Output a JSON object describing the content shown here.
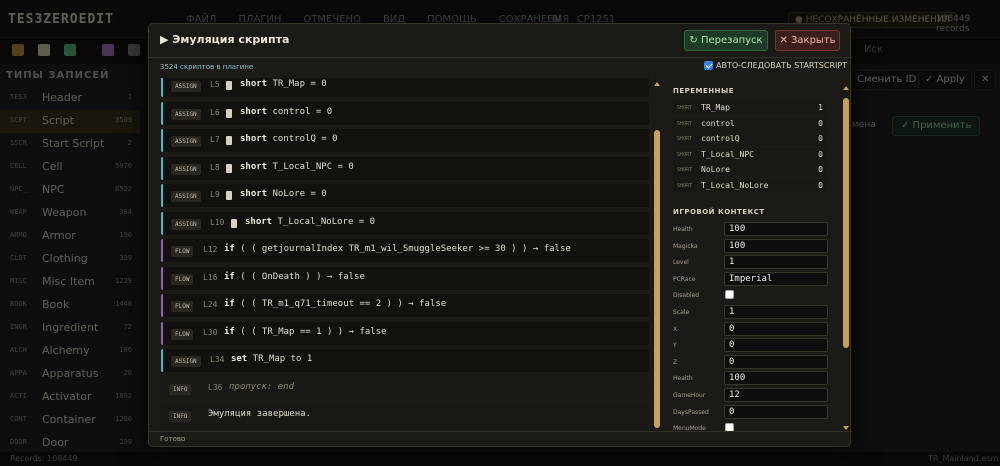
{
  "app": {
    "logo": "TES3ZEROEDIT",
    "menu": [
      "ФАЙЛ",
      "ПЛАГИН",
      "ОТМЕЧЕНО",
      "ВИД",
      "ПОМОЩЬ",
      "СОХРАНЕНИЯ"
    ],
    "lang": [
      "EN",
      "CP1251"
    ],
    "unsaved": "● НЕСОХРАНЁННЫЕ ИЗМЕНЕНИЯ",
    "record_count": "108449 records",
    "search_placeholder": "Иск",
    "sidebar_title": "ТИПЫ ЗАПИСЕЙ",
    "sidebar": [
      {
        "code": "TES3",
        "name": "Header",
        "count": "1"
      },
      {
        "code": "SCPT",
        "name": "Script",
        "count": "3509"
      },
      {
        "code": "SSCR",
        "name": "Start Script",
        "count": "2"
      },
      {
        "code": "CELL",
        "name": "Cell",
        "count": "5970"
      },
      {
        "code": "NPC_",
        "name": "NPC",
        "count": "8522"
      },
      {
        "code": "WEAP",
        "name": "Weapon",
        "count": "384"
      },
      {
        "code": "ARMO",
        "name": "Armor",
        "count": "190"
      },
      {
        "code": "CLOT",
        "name": "Clothing",
        "count": "339"
      },
      {
        "code": "MISC",
        "name": "Misc Item",
        "count": "1229"
      },
      {
        "code": "BOOK",
        "name": "Book",
        "count": "1440"
      },
      {
        "code": "INGR",
        "name": "Ingredient",
        "count": "72"
      },
      {
        "code": "ALCH",
        "name": "Alchemy",
        "count": "106"
      },
      {
        "code": "APPA",
        "name": "Apparatus",
        "count": "20"
      },
      {
        "code": "ACTI",
        "name": "Activator",
        "count": "1892"
      },
      {
        "code": "CONT",
        "name": "Container",
        "count": "1206"
      },
      {
        "code": "DOOR",
        "name": "Door",
        "count": "239"
      }
    ],
    "status_left": "Records: 108449",
    "status_right": "TR_Mainland.esm",
    "right_buttons": {
      "change_id": "Сменить ID",
      "apply": "✓ Apply",
      "x": "✕"
    },
    "right_name": "мена",
    "right_apply": "✓ Применить"
  },
  "modal": {
    "title": "▶ Эмуляция скрипта",
    "restart_label": "↻ Перезапуск",
    "close_label": "✕ Закрыть",
    "script_count": "3524 скриптов в плагине",
    "auto_follow_label": "АВТО-СЛЕДОВАТЬ STARTSCRIPT",
    "auto_follow_checked": true,
    "log": [
      {
        "type": "assign",
        "tag": "ASSIGN",
        "line": "L5",
        "code_kw": "short",
        "code_rest": " TR_Map = 0",
        "doc": true
      },
      {
        "type": "assign",
        "tag": "ASSIGN",
        "line": "L6",
        "code_kw": "short",
        "code_rest": " control = 0",
        "doc": true
      },
      {
        "type": "assign",
        "tag": "ASSIGN",
        "line": "L7",
        "code_kw": "short",
        "code_rest": " controlQ = 0",
        "doc": true
      },
      {
        "type": "assign",
        "tag": "ASSIGN",
        "line": "L8",
        "code_kw": "short",
        "code_rest": " T_Local_NPC = 0",
        "doc": true
      },
      {
        "type": "assign",
        "tag": "ASSIGN",
        "line": "L9",
        "code_kw": "short",
        "code_rest": " NoLore = 0",
        "doc": true
      },
      {
        "type": "assign",
        "tag": "ASSIGN",
        "line": "L10",
        "code_kw": "short",
        "code_rest": " T_Local_NoLore = 0",
        "doc": true
      },
      {
        "type": "flow",
        "tag": "FLOW",
        "line": "L12",
        "code_kw": "if",
        "code_rest": " ( ( getjournalIndex TR_m1_wil_SmuggleSeeker >= 30 ) ) → false",
        "doc": false
      },
      {
        "type": "flow",
        "tag": "FLOW",
        "line": "L16",
        "code_kw": "if",
        "code_rest": " ( ( OnDeath ) ) → false",
        "doc": false
      },
      {
        "type": "flow",
        "tag": "FLOW",
        "line": "L24",
        "code_kw": "if",
        "code_rest": " ( ( TR_m1_q71_timeout == 2 ) ) → false",
        "doc": false
      },
      {
        "type": "flow",
        "tag": "FLOW",
        "line": "L30",
        "code_kw": "if",
        "code_rest": " ( ( TR_Map == 1 ) ) → false",
        "doc": false
      },
      {
        "type": "assign",
        "tag": "ASSIGN",
        "line": "L34",
        "code_kw": "set",
        "code_rest": " TR_Map to 1",
        "doc": false
      },
      {
        "type": "info",
        "tag": "INFO",
        "line": "L36",
        "code_kw": "",
        "code_rest": "пропуск: end",
        "doc": false
      },
      {
        "type": "info",
        "tag": "INFO",
        "line": "",
        "code_kw": "",
        "code_rest": "Эмуляция завершена.",
        "doc": false
      }
    ],
    "vars_title": "ПЕРЕМЕННЫЕ",
    "vars": [
      {
        "type": "SHORT",
        "name": "TR_Map",
        "value": "1"
      },
      {
        "type": "SHORT",
        "name": "control",
        "value": "0"
      },
      {
        "type": "SHORT",
        "name": "controlQ",
        "value": "0"
      },
      {
        "type": "SHORT",
        "name": "T_Local_NPC",
        "value": "0"
      },
      {
        "type": "SHORT",
        "name": "NoLore",
        "value": "0"
      },
      {
        "type": "SHORT",
        "name": "T_Local_NoLore",
        "value": "0"
      }
    ],
    "ctx_title": "ИГРОВОЙ КОНТЕКСТ",
    "ctx": [
      {
        "key": "Health",
        "value": "100"
      },
      {
        "key": "Magicka",
        "value": "100"
      },
      {
        "key": "Level",
        "value": "1"
      },
      {
        "key": "PCRace",
        "value": "Imperial"
      },
      {
        "key": "Disabled",
        "checkbox": true,
        "checked": false
      },
      {
        "key": "Scale",
        "value": "1"
      },
      {
        "key": "X",
        "value": "0"
      },
      {
        "key": "Y",
        "value": "0"
      },
      {
        "key": "Z",
        "value": "0"
      },
      {
        "key": "Health",
        "value": "100"
      },
      {
        "key": "GameHour",
        "value": "12"
      },
      {
        "key": "DaysPassed",
        "value": "0"
      },
      {
        "key": "MenuMode",
        "checkbox": true,
        "checked": false
      }
    ],
    "footer": "Готово"
  },
  "colors": {
    "accent": "#c6a060",
    "assign": "#5ab2c8",
    "flow": "#8e63b8",
    "restart": "#2f6a3a",
    "close": "#7a3330"
  }
}
